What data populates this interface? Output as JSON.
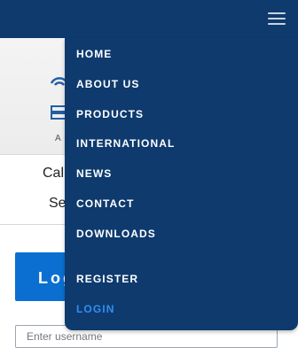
{
  "nav": {
    "items": [
      {
        "label": "HOME"
      },
      {
        "label": "ABOUT US"
      },
      {
        "label": "PRODUCTS"
      },
      {
        "label": "INTERNATIONAL"
      },
      {
        "label": "NEWS"
      },
      {
        "label": "CONTACT"
      },
      {
        "label": "DOWNLOADS"
      },
      {
        "label": "REGISTER"
      },
      {
        "label": "LOGIN"
      }
    ],
    "active_label": "LOGIN"
  },
  "page": {
    "logo_text": "A",
    "call_text": "Call",
    "se_text": "Se",
    "login_banner_text": "Log",
    "username_placeholder": "Enter username"
  },
  "colors": {
    "header": "#0e3a6e",
    "active_link": "#2f8ff0",
    "banner": "#0a6fd1"
  },
  "icons": {
    "menu": "hamburger-menu-icon",
    "logo": "company-logo-icon"
  }
}
